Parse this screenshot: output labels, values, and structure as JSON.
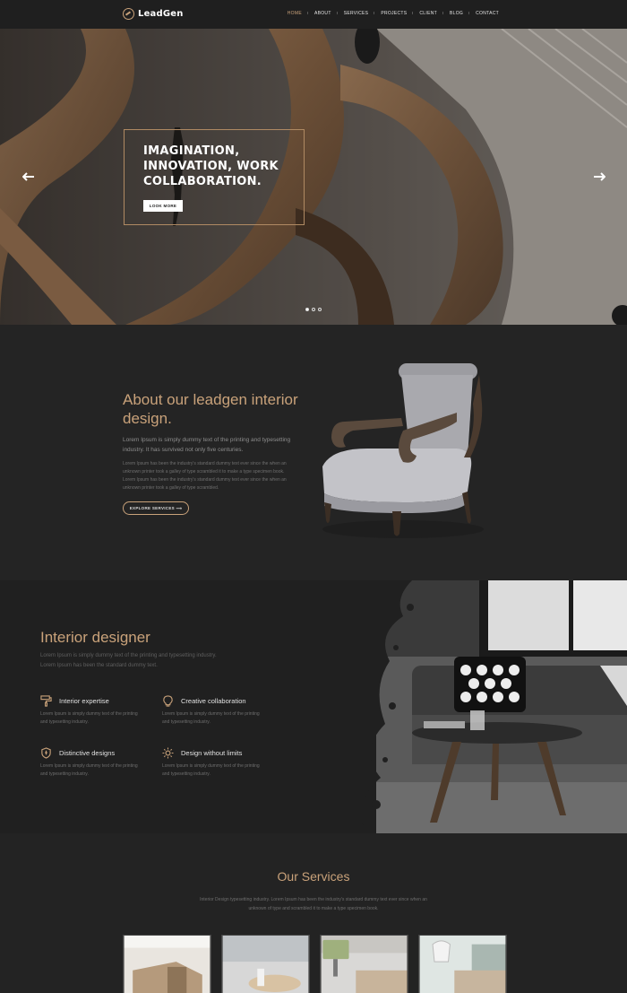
{
  "brand": {
    "name": "LeadGen",
    "accent": "#c9a27a"
  },
  "nav": {
    "items": [
      {
        "label": "HOME",
        "active": true
      },
      {
        "label": "ABOUT",
        "active": false
      },
      {
        "label": "SERVICES",
        "active": false
      },
      {
        "label": "PROJECTS",
        "active": false
      },
      {
        "label": "CLIENT",
        "active": false
      },
      {
        "label": "BLOG",
        "active": false
      },
      {
        "label": "CONTACT",
        "active": false
      }
    ]
  },
  "hero": {
    "title": "IMAGINATION, INNOVATION, WORK COLLABORATION.",
    "button": "LOOK MORE",
    "prev_icon": "arrow-left-icon",
    "next_icon": "arrow-right-icon",
    "slides": 3,
    "active_slide": 1
  },
  "about": {
    "title": "About our leadgen interior design.",
    "lead": "Lorem Ipsum is simply dummy text of the printing and typesetting industry. It has survived not only five centuries.",
    "body": "Lorem Ipsum has been the industry's standard dummy text ever since the when an unknown printer took a galley of type scrambled it to make a type specimen book. Lorem Ipsum has been the industry's standard dummy text ever since the when an unknown printer took a galley of type scrambled.",
    "button": "EXPLORE SERVICES"
  },
  "interior": {
    "title": "Interior designer",
    "description": "Lorem Ipsum is simply dummy text of the printing and typesetting industry. Lorem Ipsum has been the standard dummy text.",
    "features": [
      {
        "title": "Interior expertise",
        "text": "Lorem Ipsum is simply dummy text of the printing and typesetting industry.",
        "icon": "paint-roller-icon"
      },
      {
        "title": "Creative collaboration",
        "text": "Lorem Ipsum is simply dummy text of the printing and typesetting industry.",
        "icon": "lightbulb-icon"
      },
      {
        "title": "Distinctive designs",
        "text": "Lorem Ipsum is simply dummy text of the printing and typesetting industry.",
        "icon": "shield-icon"
      },
      {
        "title": "Design without limits",
        "text": "Lorem Ipsum is simply dummy text of the printing and typesetting industry.",
        "icon": "sun-icon"
      }
    ]
  },
  "services": {
    "title": "Our Services",
    "description": "Interior Design typesetting industry. Lorem Ipsum has been the industry's standard dummy text ever since when an unknown of type and scrambled it to make a type specimen book."
  }
}
